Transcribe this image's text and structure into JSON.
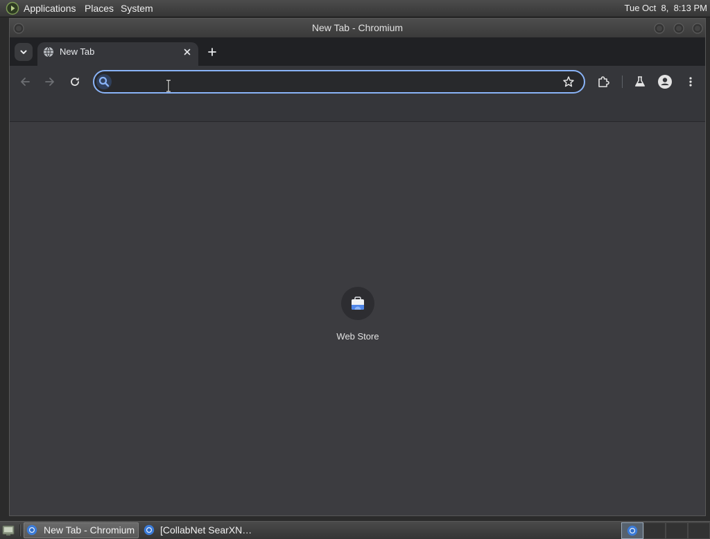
{
  "panel": {
    "menus": [
      "Applications",
      "Places",
      "System"
    ],
    "clock": "Tue Oct  8,  8:13 PM"
  },
  "window": {
    "title": "New Tab - Chromium"
  },
  "browser": {
    "tabs": [
      {
        "title": "New Tab",
        "favicon": "globe-icon",
        "active": true
      }
    ],
    "toolbar": {
      "back_enabled": false,
      "forward_enabled": false,
      "reload_enabled": true,
      "icons": [
        "back-arrow-icon",
        "forward-arrow-icon",
        "reload-icon",
        "bookmark-star-icon",
        "extensions-puzzle-icon",
        "labs-flask-icon",
        "profile-icon",
        "kebab-menu-icon"
      ]
    },
    "omnibox": {
      "value": "",
      "focused": true,
      "icon": "search-icon"
    },
    "shortcuts": [
      {
        "label": "Web Store",
        "icon": "web-store-icon"
      }
    ]
  },
  "taskbar": {
    "tasks": [
      {
        "label": "New Tab - Chromium",
        "icon": "chromium-icon",
        "active": true
      },
      {
        "label": "[CollabNet SearXN…",
        "icon": "chromium-icon",
        "active": false
      }
    ],
    "workspaces": [
      {
        "active": true,
        "icon": "chromium-icon"
      },
      {
        "active": false
      },
      {
        "active": false
      },
      {
        "active": false
      }
    ]
  },
  "colors": {
    "accent": "#8ab4f8",
    "frame": "#202124",
    "toolbar": "#35363a",
    "content": "#3c3c40"
  }
}
